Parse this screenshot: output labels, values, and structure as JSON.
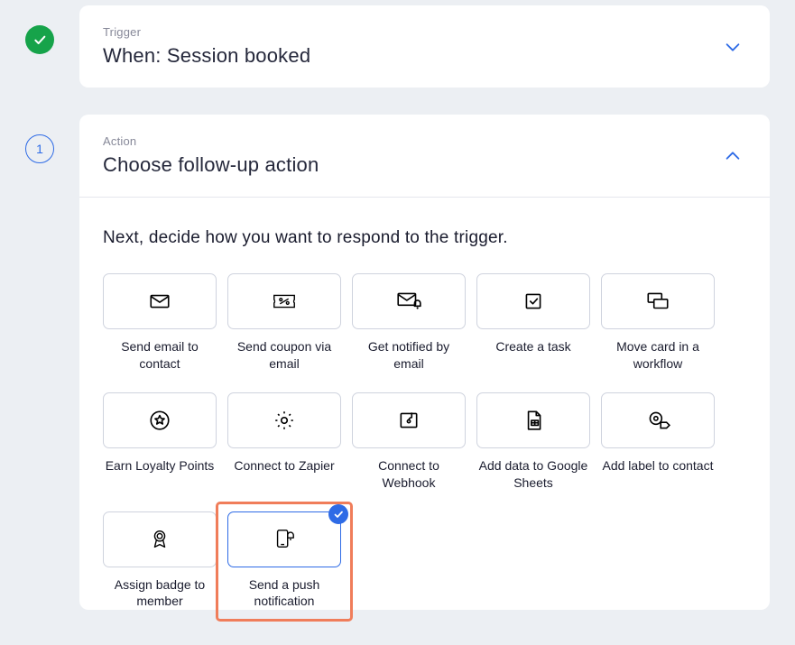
{
  "trigger": {
    "eyebrow": "Trigger",
    "title": "When: Session booked"
  },
  "action_step": {
    "number": "1",
    "eyebrow": "Action",
    "title": "Choose follow-up action",
    "prompt": "Next, decide how you want to respond to the trigger."
  },
  "actions": [
    {
      "key": "send-email",
      "label": "Send email to contact",
      "icon": "mail",
      "selected": false,
      "highlight": false
    },
    {
      "key": "send-coupon",
      "label": "Send coupon via email",
      "icon": "coupon",
      "selected": false,
      "highlight": false
    },
    {
      "key": "notify-email",
      "label": "Get notified by email",
      "icon": "mail-bell",
      "selected": false,
      "highlight": false
    },
    {
      "key": "create-task",
      "label": "Create a task",
      "icon": "task",
      "selected": false,
      "highlight": false
    },
    {
      "key": "move-card",
      "label": "Move card in a workflow",
      "icon": "workflow",
      "selected": false,
      "highlight": false
    },
    {
      "key": "earn-loyalty",
      "label": "Earn Loyalty Points",
      "icon": "star-circle",
      "selected": false,
      "highlight": false
    },
    {
      "key": "zapier",
      "label": "Connect to Zapier",
      "icon": "gear",
      "selected": false,
      "highlight": false
    },
    {
      "key": "webhook",
      "label": "Connect to Webhook",
      "icon": "webhook",
      "selected": false,
      "highlight": false
    },
    {
      "key": "google-sheets",
      "label": "Add data to Google Sheets",
      "icon": "sheets",
      "selected": false,
      "highlight": false
    },
    {
      "key": "add-label",
      "label": "Add label to contact",
      "icon": "label",
      "selected": false,
      "highlight": false
    },
    {
      "key": "assign-badge",
      "label": "Assign badge to member",
      "icon": "badge",
      "selected": false,
      "highlight": false
    },
    {
      "key": "push-notify",
      "label": "Send a push notification",
      "icon": "push",
      "selected": true,
      "highlight": true
    }
  ]
}
